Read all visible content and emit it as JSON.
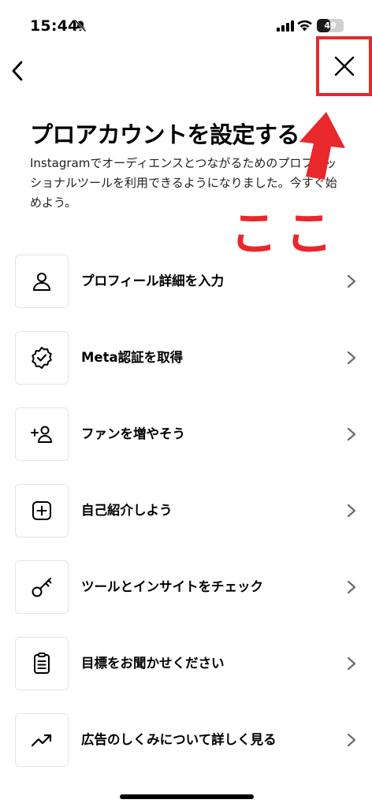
{
  "status_bar": {
    "time": "15:44",
    "battery_level": "49",
    "battery_fraction": 0.49
  },
  "header": {
    "back_icon": "chevron-left-icon",
    "close_icon": "close-icon",
    "close_highlight_color": "#e8282b"
  },
  "title": "プロアカウントを設定する",
  "description": "Instagramでオーディエンスとつながるためのプロフェッショナルツールを利用できるようになりました。今すぐ始めよう。",
  "annotation": {
    "text": "ここ",
    "color": "#e8282b"
  },
  "menu": [
    {
      "label": "プロフィール詳細を入力",
      "icon": "person-icon"
    },
    {
      "label": "Meta認証を取得",
      "icon": "verified-badge-icon"
    },
    {
      "label": "ファンを増やそう",
      "icon": "add-person-icon"
    },
    {
      "label": "自己紹介しよう",
      "icon": "add-square-icon"
    },
    {
      "label": "ツールとインサイトをチェック",
      "icon": "key-icon"
    },
    {
      "label": "目標をお聞かせください",
      "icon": "clipboard-icon"
    },
    {
      "label": "広告のしくみについて詳しく見る",
      "icon": "trending-up-icon"
    }
  ]
}
